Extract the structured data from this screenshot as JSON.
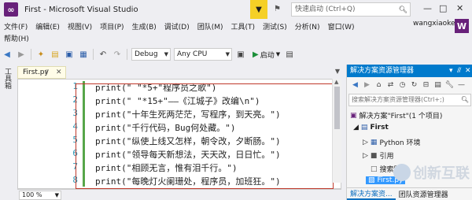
{
  "window": {
    "title": "First - Microsoft Visual Studio",
    "quick_launch_placeholder": "快速启动 (Ctrl+Q)",
    "user": "wangxiaoke",
    "avatar": "W"
  },
  "menu": [
    "文件(F)",
    "编辑(E)",
    "视图(V)",
    "项目(P)",
    "生成(B)",
    "调试(D)",
    "团队(M)",
    "工具(T)",
    "测试(S)",
    "分析(N)",
    "窗口(W)"
  ],
  "help_menu": "帮助(H)",
  "toolbar": {
    "config": "Debug",
    "platform": "Any CPU",
    "start_label": "启动"
  },
  "toolbox_label": "工具箱",
  "editor": {
    "tab_label": "First.py",
    "zoom": "100 %",
    "lines": [
      {
        "num": "1",
        "code": "print(\" \"*5+\"程序员之歌\")"
      },
      {
        "num": "2",
        "code": "print(\" \"*15+\"——《江城子》改编\\n\")"
      },
      {
        "num": "3",
        "code": "print(\"十年生死两茫茫，写程序，到天亮。\")"
      },
      {
        "num": "4",
        "code": "print(\"千行代码，Bug何处藏。\")"
      },
      {
        "num": "5",
        "code": "print(\"纵使上线又怎样，朝令改，夕断肠。\")"
      },
      {
        "num": "6",
        "code": "print(\"领导每天新想法，天天改，日日忙。\")"
      },
      {
        "num": "7",
        "code": "print(\"相顾无言，惟有泪千行。\")"
      },
      {
        "num": "8",
        "code": "print(\"每晚灯火阑珊处，程序员，加班狂。\")"
      }
    ]
  },
  "solution_explorer": {
    "title": "解决方案资源管理器",
    "search_placeholder": "搜索解决方案资源管理器(Ctrl+;)",
    "tree": [
      {
        "label": "解决方案\"First\"(1 个项目)",
        "icon": "solution-icon"
      },
      {
        "label": "First",
        "icon": "python-project-icon"
      },
      {
        "label": "Python 环境",
        "icon": "python-env-icon"
      },
      {
        "label": "引用",
        "icon": "references-icon"
      },
      {
        "label": "搜索路径",
        "icon": "search-path-icon"
      },
      {
        "label": "First.py",
        "icon": "python-file-icon"
      }
    ],
    "tabs": [
      "解决方案资...",
      "团队资源管理器"
    ]
  },
  "watermark": "创新互联"
}
